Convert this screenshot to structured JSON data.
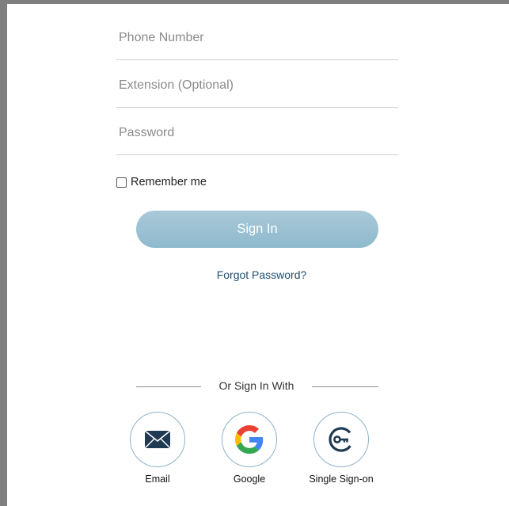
{
  "form": {
    "phone_placeholder": "Phone Number",
    "extension_placeholder": "Extension (Optional)",
    "password_placeholder": "Password",
    "remember_label": "Remember me",
    "signin_label": "Sign In",
    "forgot_label": "Forgot Password?"
  },
  "alt_signin": {
    "divider_text": "Or Sign In With",
    "options": [
      {
        "label": "Email",
        "icon": "envelope-icon"
      },
      {
        "label": "Google",
        "icon": "google-icon"
      },
      {
        "label": "Single Sign-on",
        "icon": "key-icon"
      }
    ]
  },
  "colors": {
    "signin_button": "#9cc3d5",
    "link": "#1d4f73",
    "icon_dark": "#1f3a52"
  }
}
